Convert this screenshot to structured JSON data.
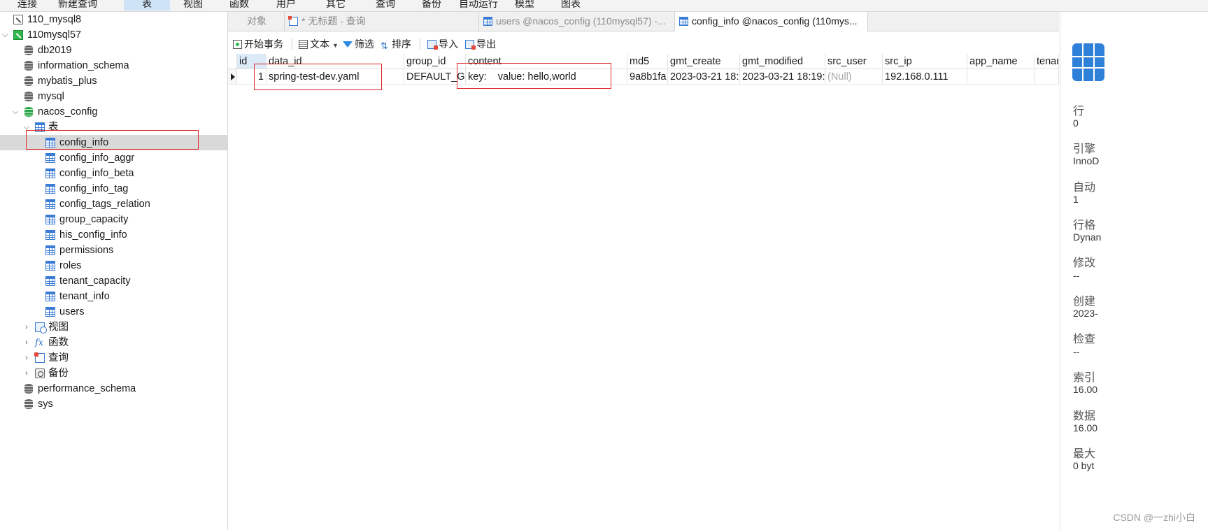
{
  "menu": {
    "items": [
      "连接",
      "新建查询",
      "表",
      "视图",
      "函数",
      "用户",
      "其它",
      "查询",
      "备份",
      "自动运行",
      "模型",
      "图表"
    ],
    "active_index": 2
  },
  "tree": {
    "connections": [
      {
        "label": "110_mysql8"
      },
      {
        "label": "110mysql57"
      }
    ],
    "databases": [
      "db2019",
      "information_schema",
      "mybatis_plus",
      "mysql",
      "nacos_config"
    ],
    "tables_group": "表",
    "tables": [
      "config_info",
      "config_info_aggr",
      "config_info_beta",
      "config_info_tag",
      "config_tags_relation",
      "group_capacity",
      "his_config_info",
      "permissions",
      "roles",
      "tenant_capacity",
      "tenant_info",
      "users"
    ],
    "selected_table": "config_info",
    "groups": [
      "视图",
      "函数",
      "查询",
      "备份"
    ],
    "other_databases": [
      "performance_schema",
      "sys"
    ]
  },
  "tabs": [
    {
      "label": "对象"
    },
    {
      "label": "* 无标题 - 查询"
    },
    {
      "label": "users @nacos_config (110mysql57) -..."
    },
    {
      "label": "config_info @nacos_config (110mys..."
    }
  ],
  "toolbar": {
    "begin_transaction": "开始事务",
    "text": "文本",
    "filter": "筛选",
    "sort": "排序",
    "import": "导入",
    "export": "导出"
  },
  "grid": {
    "columns": [
      "id",
      "data_id",
      "group_id",
      "content",
      "md5",
      "gmt_create",
      "gmt_modified",
      "src_user",
      "src_ip",
      "app_name",
      "tenan"
    ],
    "rows": [
      [
        "1",
        "spring-test-dev.yaml",
        "DEFAULT_GR",
        "key:    value: hello,world",
        "9a8b1fa",
        "2023-03-21 18:",
        "2023-03-21 18:19:",
        "(Null)",
        "192.168.0.111",
        "",
        ""
      ]
    ]
  },
  "info": {
    "items": [
      {
        "label": "行",
        "value": "0"
      },
      {
        "label": "引擎",
        "value": "InnoD"
      },
      {
        "label": "自动",
        "value": "1"
      },
      {
        "label": "行格",
        "value": "Dynan"
      },
      {
        "label": "修改",
        "value": "--"
      },
      {
        "label": "创建",
        "value": "2023-"
      },
      {
        "label": "检查",
        "value": "--"
      },
      {
        "label": "索引",
        "value": "16.00"
      },
      {
        "label": "数据",
        "value": "16.00"
      },
      {
        "label": "最大",
        "value": "0 byt"
      }
    ]
  },
  "watermark": "CSDN @一zhi小白"
}
